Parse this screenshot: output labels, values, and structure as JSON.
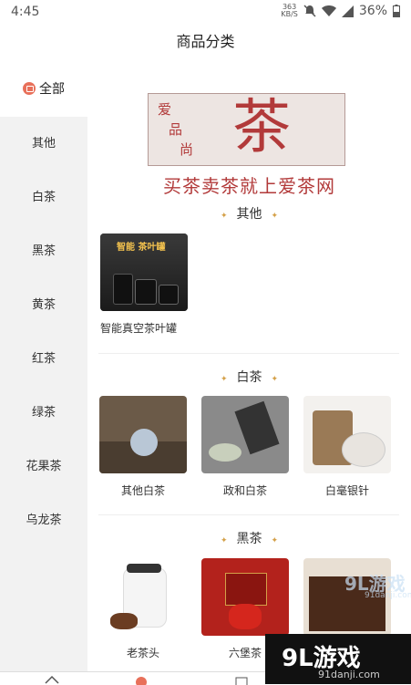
{
  "status": {
    "time": "4:45",
    "net_speed_value": "363",
    "net_speed_unit": "KB/S",
    "battery": "36%"
  },
  "header": {
    "title": "商品分类"
  },
  "sidebar": {
    "all_label": "全部",
    "items": [
      {
        "label": "其他"
      },
      {
        "label": "白茶"
      },
      {
        "label": "黑茶"
      },
      {
        "label": "黄茶"
      },
      {
        "label": "红茶"
      },
      {
        "label": "绿茶"
      },
      {
        "label": "花果茶"
      },
      {
        "label": "乌龙茶"
      }
    ]
  },
  "banner": {
    "logo_small_chars": [
      "爱",
      "品",
      "尚"
    ],
    "logo_big_char": "茶",
    "slogan": "买茶卖茶就上爱茶网"
  },
  "sections": [
    {
      "title": "其他",
      "products": [
        {
          "name": "智能真空茶叶罐",
          "image_text": "智能 茶叶罐"
        }
      ]
    },
    {
      "title": "白茶",
      "products": [
        {
          "name": "其他白茶"
        },
        {
          "name": "政和白茶"
        },
        {
          "name": "白毫银针"
        }
      ]
    },
    {
      "title": "黑茶",
      "products": [
        {
          "name": "老茶头"
        },
        {
          "name": "六堡茶"
        }
      ]
    }
  ],
  "watermark": {
    "text": "9L游戏",
    "site": "91danji.com",
    "mid_text": "9L游戏",
    "mid_site": "91danji.com"
  },
  "colors": {
    "accent": "#b23a3a",
    "sidebar_bg": "#f2f2f2",
    "sparkle": "#d4a048"
  }
}
